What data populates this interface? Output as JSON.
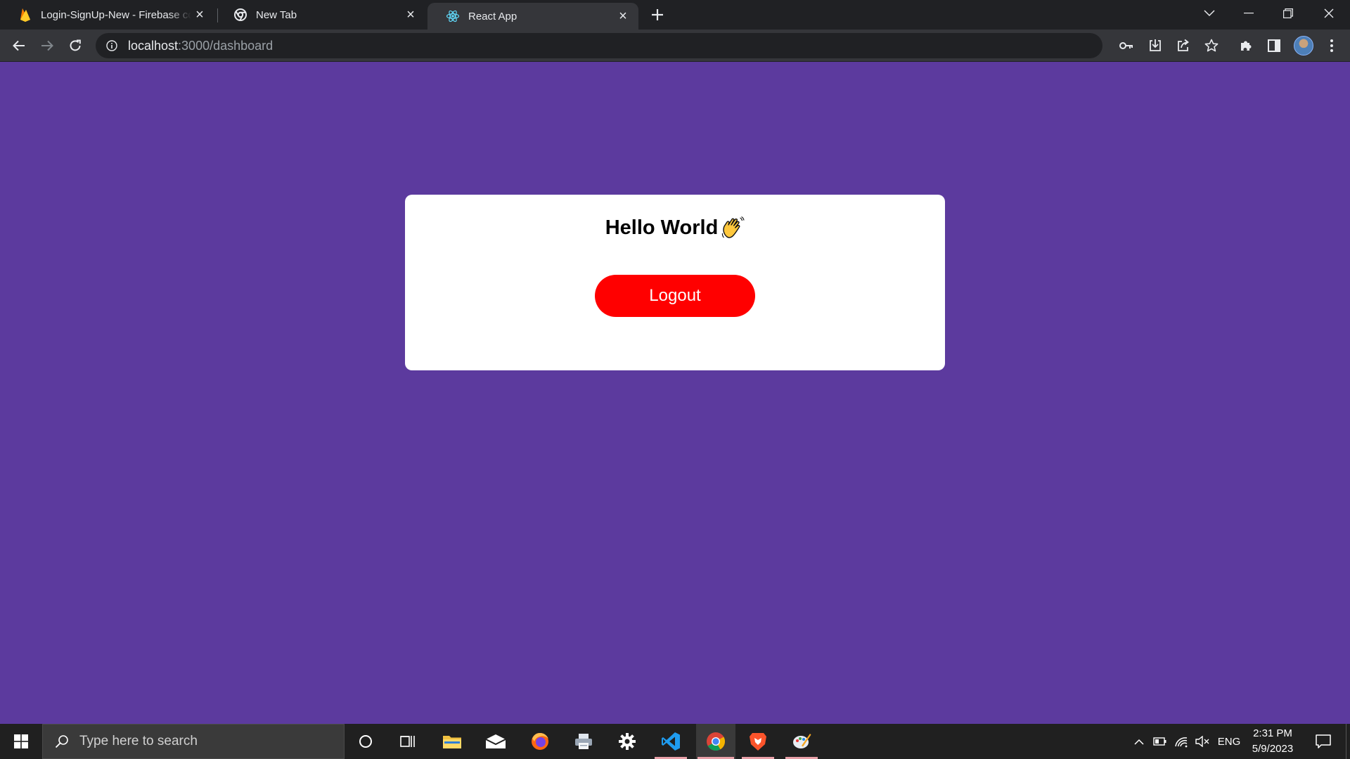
{
  "browser": {
    "tabs": [
      {
        "title": "Login-SignUp-New - Firebase co",
        "icon": "firebase-icon",
        "active": false
      },
      {
        "title": "New Tab",
        "icon": "chrome-icon",
        "active": false
      },
      {
        "title": "React App",
        "icon": "react-icon",
        "active": true
      }
    ],
    "address": {
      "host": "localhost",
      "path": ":3000/dashboard"
    }
  },
  "page": {
    "heading": "Hello World",
    "heading_emoji": "waving-hand-icon",
    "logout_label": "Logout",
    "colors": {
      "background": "#5c3a9e",
      "card": "#ffffff",
      "logout": "#ff0000"
    }
  },
  "taskbar": {
    "search_placeholder": "Type here to search",
    "apps": [
      "cortana-icon",
      "task-view-icon",
      "file-explorer-icon",
      "mail-icon",
      "firefox-icon",
      "printer-icon",
      "settings-icon",
      "vscode-icon",
      "chrome-icon",
      "brave-icon",
      "paint-icon"
    ],
    "language": "ENG",
    "time": "2:31 PM",
    "date": "5/9/2023"
  }
}
